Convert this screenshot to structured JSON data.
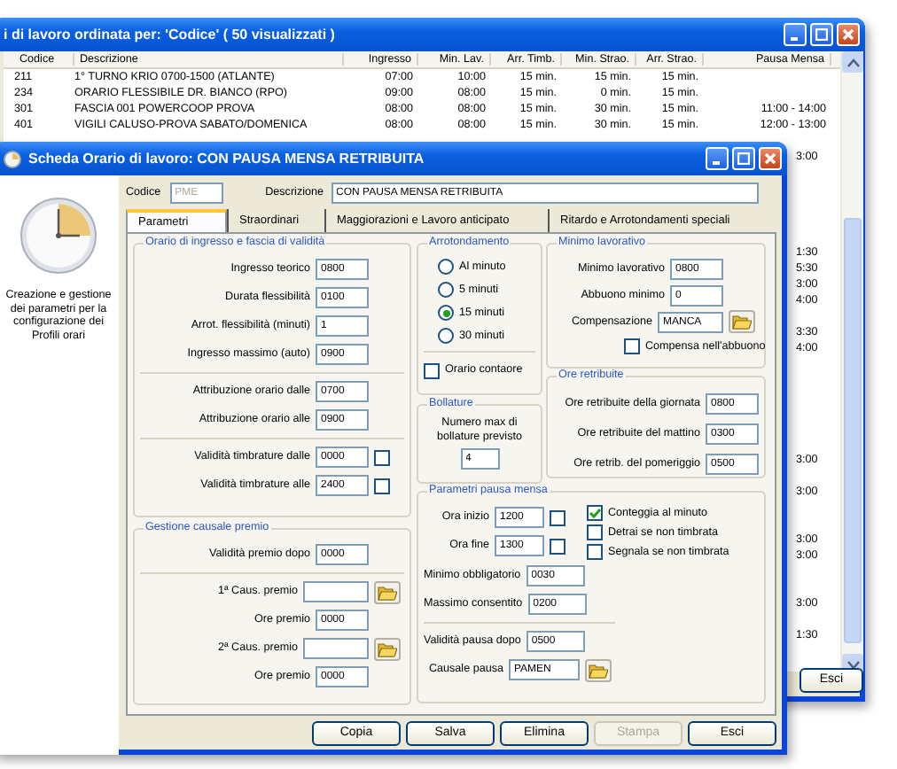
{
  "list_window": {
    "title": "i di lavoro ordinata per: 'Codice' ( 50 visualizzati )",
    "columns": [
      "Codice",
      "Descrizione",
      "Ingresso",
      "Min. Lav.",
      "Arr. Timb.",
      "Min. Strao.",
      "Arr. Strao.",
      "Pausa Mensa"
    ],
    "rows": [
      {
        "cells": [
          "211",
          "1° TURNO KRIO 0700-1500 (ATLANTE)",
          "07:00",
          "10:00",
          "15 min.",
          "15 min.",
          "15 min."
        ]
      },
      {
        "cells": [
          "234",
          "ORARIO FLESSIBILE DR. BIANCO (RPO)",
          "09:00",
          "08:00",
          "15 min.",
          "0 min.",
          "15 min."
        ]
      },
      {
        "cells": [
          "301",
          "FASCIA 001 POWERCOOP PROVA",
          "08:00",
          "08:00",
          "15 min.",
          "30 min.",
          "15 min.",
          "11:00 - 14:00"
        ]
      },
      {
        "cells": [
          "401",
          "VIGILI CALUSO-PROVA SABATO/DOMENICA",
          "08:00",
          "08:00",
          "15 min.",
          "30 min.",
          "15 min.",
          "12:00 - 13:00"
        ]
      }
    ],
    "covered_rows": [
      {},
      {
        "pausa_mensa": "3:00"
      },
      {},
      {},
      {},
      {},
      {},
      {
        "pausa_mensa": "1:30"
      },
      {
        "pausa_mensa": "5:30"
      },
      {
        "pausa_mensa": "3:00"
      },
      {
        "pausa_mensa": "4:00"
      },
      {},
      {
        "pausa_mensa": "3:30"
      },
      {
        "pausa_mensa": "4:00"
      },
      {},
      {},
      {},
      {},
      {},
      {},
      {
        "pausa_mensa": "3:00"
      },
      {},
      {
        "pausa_mensa": "3:00"
      },
      {},
      {},
      {
        "pausa_mensa": "3:00"
      },
      {
        "pausa_mensa": "3:00"
      },
      {},
      {},
      {
        "pausa_mensa": "3:00"
      },
      {},
      {
        "pausa_mensa": "1:30"
      }
    ],
    "button": "Esci"
  },
  "window": {
    "title": "Scheda Orario di lavoro: CON PAUSA MENSA RETRIBUITA",
    "sidebar_text": "Creazione e gestione dei parametri per la configurazione dei Profili orari",
    "codice": {
      "label": "Codice",
      "value": "PME",
      "disabled": true
    },
    "descrizione": {
      "label": "Descrizione",
      "value": "CON PAUSA MENSA RETRIBUITA"
    },
    "tabs": [
      {
        "label": "Parametri",
        "selected": true
      },
      {
        "label": "Straordinari",
        "selected": false
      },
      {
        "label": "Maggiorazioni e Lavoro anticipato",
        "selected": false
      },
      {
        "label": "Ritardo e Arrotondamenti speciali",
        "selected": false
      }
    ],
    "orario": {
      "title": "Orario di ingresso e fascia di validità",
      "sections": [
        [
          {
            "label": "Ingresso teorico",
            "value": "0800",
            "kind": "text"
          },
          {
            "label": "Durata flessibilità",
            "value": "0100",
            "kind": "text"
          },
          {
            "label": "Arrot. flessibilità (minuti)",
            "value": "1",
            "kind": "text"
          },
          {
            "label": "Ingresso massimo (auto)",
            "value": "0900",
            "kind": "text"
          }
        ],
        [
          {
            "label": "Attribuzione orario dalle",
            "value": "0700",
            "kind": "text"
          },
          {
            "label": "Attribuzione orario alle",
            "value": "0900",
            "kind": "text"
          }
        ],
        [
          {
            "label": "Validità timbrature dalle",
            "value": "0000",
            "kind": "check",
            "checked": false
          },
          {
            "label": "Validità timbrature alle",
            "value": "2400",
            "kind": "check",
            "checked": false
          }
        ]
      ]
    },
    "premio": {
      "title": "Gestione causale premio",
      "sections": [
        [
          {
            "label": "Validità premio dopo",
            "value": "0000",
            "kind": "text"
          }
        ],
        [
          {
            "label": "1ª Caus. premio",
            "kind": "browse"
          },
          {
            "label": "Ore premio",
            "value": "0000",
            "kind": "text"
          },
          {
            "label": "2ª Caus. premio",
            "kind": "browse"
          },
          {
            "label": "Ore premio",
            "value": "0000",
            "kind": "text"
          }
        ]
      ]
    },
    "arrotondamento": {
      "title": "Arrotondamento",
      "options": [
        {
          "label": "Al minuto",
          "selected": false
        },
        {
          "label": "5 minuti",
          "selected": false
        },
        {
          "label": "15 minuti",
          "selected": true
        },
        {
          "label": "30 minuti",
          "selected": false
        }
      ],
      "contaore": {
        "label": "Orario contaore",
        "checked": false
      }
    },
    "bollature": {
      "title": "Bollature",
      "text": "Numero max di bollature previsto",
      "value": "4"
    },
    "minimo": {
      "title": "Minimo lavorativo",
      "fields": [
        {
          "label": "Minimo lavorativo",
          "value": "0800",
          "kind": "text"
        },
        {
          "label": "Abbuono minimo",
          "value": "0",
          "kind": "text"
        },
        {
          "label": "Compensazione",
          "value": "MANCA",
          "kind": "browse"
        }
      ],
      "check": {
        "label": "Compensa nell'abbuono",
        "checked": false
      }
    },
    "ore_retribuite": {
      "title": "Ore retribuite",
      "fields": [
        {
          "label": "Ore retribuite della giornata",
          "value": "0800",
          "kind": "text"
        },
        {
          "label": "Ore retribuite del mattino",
          "value": "0300",
          "kind": "text"
        },
        {
          "label": "Ore retrib. del pomeriggio",
          "value": "0500",
          "kind": "text"
        }
      ]
    },
    "pausa": {
      "title": "Parametri pausa mensa",
      "fields": [
        {
          "label": "Ora inizio",
          "value": "1200",
          "kind": "check",
          "checked": false
        },
        {
          "label": "Ora fine",
          "value": "1300",
          "kind": "check",
          "checked": false
        }
      ],
      "checks": [
        {
          "label": "Conteggia al minuto",
          "checked": true
        },
        {
          "label": "Detrai se non timbrata",
          "checked": false
        },
        {
          "label": "Segnala se non timbrata",
          "checked": false
        }
      ],
      "sections": [
        [
          {
            "label": "Minimo obbligatorio",
            "value": "0030",
            "kind": "text"
          },
          {
            "label": "Massimo consentito",
            "value": "0200",
            "kind": "text"
          }
        ],
        [
          {
            "label": "Validità pausa dopo",
            "value": "0500",
            "kind": "text"
          },
          {
            "label": "Causale pausa",
            "value": "PAMEN",
            "kind": "browse"
          }
        ]
      ]
    },
    "buttons": [
      {
        "label": "Copia",
        "disabled": false
      },
      {
        "label": "Salva",
        "disabled": false
      },
      {
        "label": "Elimina",
        "disabled": false
      },
      {
        "label": "Stampa",
        "disabled": true
      },
      {
        "label": "Esci",
        "disabled": false
      }
    ]
  }
}
